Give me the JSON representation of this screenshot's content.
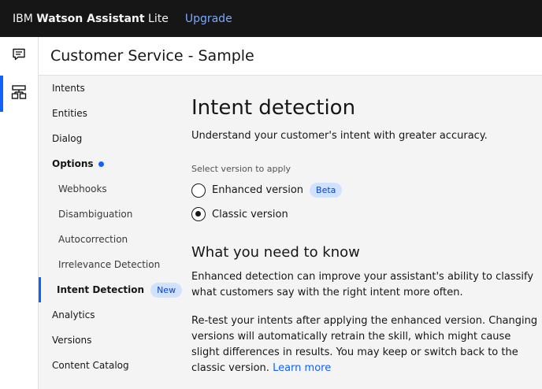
{
  "header": {
    "brand_ibm": "IBM ",
    "brand_product": "Watson Assistant",
    "brand_tier": " Lite",
    "upgrade": "Upgrade"
  },
  "rail": {
    "items": [
      {
        "icon": "chat-icon"
      },
      {
        "icon": "skills-icon",
        "active": true
      }
    ]
  },
  "page": {
    "title": "Customer Service - Sample"
  },
  "nav": {
    "intents": "Intents",
    "entities": "Entities",
    "dialog": "Dialog",
    "options": "Options",
    "webhooks": "Webhooks",
    "disambiguation": "Disambiguation",
    "autocorrection": "Autocorrection",
    "irrelevance": "Irrelevance Detection",
    "intent_detection": "Intent Detection",
    "intent_detection_tag": "New",
    "analytics": "Analytics",
    "versions": "Versions",
    "content_catalog": "Content Catalog"
  },
  "main": {
    "heading": "Intent detection",
    "lead": "Understand your customer's intent with greater accuracy.",
    "select_label": "Select version to apply",
    "options": [
      {
        "label": "Enhanced version",
        "tag": "Beta",
        "selected": false
      },
      {
        "label": "Classic version",
        "selected": true
      }
    ],
    "know_heading": "What you need to know",
    "para1": "Enhanced detection can improve your assistant's ability to classify what customers say with the right intent more often.",
    "para2": "Re-test your intents after applying the enhanced version. Changing versions will automatically retrain the skill, which might cause slight differences in results. You may keep or switch back to the classic version.",
    "learn_more": "Learn more"
  },
  "colors": {
    "accent": "#0f62fe",
    "header_bg": "#161616",
    "tag_bg": "#d0e2ff",
    "link": "#78a9ff"
  }
}
